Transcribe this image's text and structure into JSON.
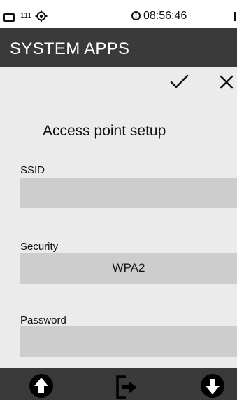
{
  "status_bar": {
    "signal_text": "111",
    "time": "08:56:46",
    "icons": [
      "battery-icon",
      "gps-icon",
      "alert-icon"
    ]
  },
  "header": {
    "title": "SYSTEM APPS"
  },
  "actions": {
    "confirm_icon": "check-icon",
    "cancel_icon": "close-icon"
  },
  "page": {
    "heading": "Access point setup"
  },
  "form": {
    "ssid": {
      "label": "SSID",
      "value": ""
    },
    "security": {
      "label": "Security",
      "value": "WPA2"
    },
    "password": {
      "label": "Password",
      "value": ""
    }
  },
  "bottom_nav": {
    "icons": [
      "arrow-up-circle-icon",
      "exit-icon",
      "arrow-down-circle-icon"
    ]
  },
  "colors": {
    "header_bg": "#3a3a3a",
    "screen_bg": "#ebebeb",
    "field_bg": "#cdcdcd"
  }
}
